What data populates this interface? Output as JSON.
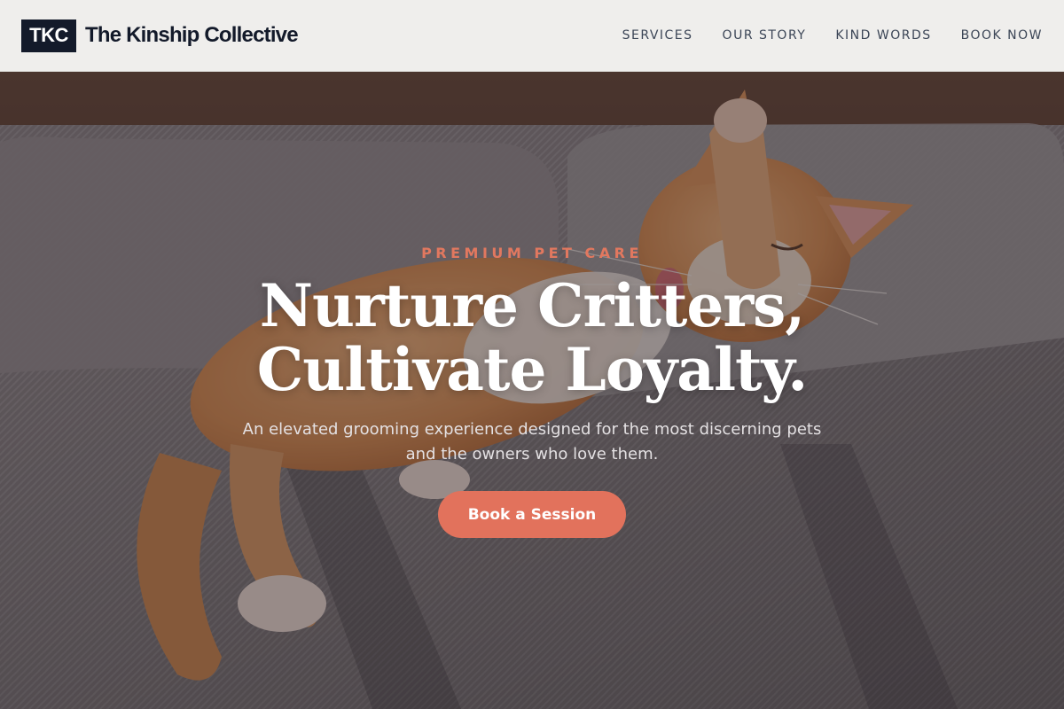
{
  "header": {
    "logo_text": "TKC",
    "brand_name": "The Kinship Collective",
    "nav": [
      {
        "label": "SERVICES"
      },
      {
        "label": "OUR STORY"
      },
      {
        "label": "KIND WORDS"
      },
      {
        "label": "BOOK NOW"
      }
    ]
  },
  "hero": {
    "eyebrow": "PREMIUM PET CARE",
    "headline_line1": "Nurture Critters,",
    "headline_line2": "Cultivate Loyalty.",
    "subtext": "An elevated grooming experience designed for the most discerning pets and the owners who love them.",
    "cta_label": "Book a Session",
    "image_subject": "orange-tabby-cat-on-sofa"
  },
  "colors": {
    "navy": "#131a2a",
    "accent": "#e2725c",
    "header_bg": "#efeeec",
    "nav_text": "#3b4556"
  }
}
